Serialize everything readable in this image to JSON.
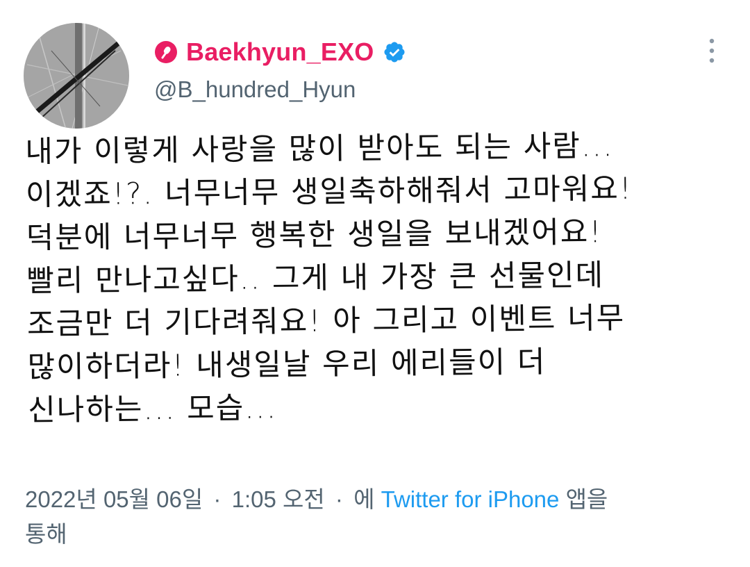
{
  "author": {
    "display_name": "Baekhyun_EXO",
    "handle": "@B_hundred_Hyun",
    "name_color": "#e91e63",
    "badge_icon": "microphone-badge-icon",
    "verified_icon": "verified-badge-icon"
  },
  "tweet": {
    "lines": [
      "내가 이렇게 사랑을 많이 받아도 되는 사람...",
      "이겠죠!?. 너무너무 생일축하해줘서 고마워요!",
      "덕분에 너무너무 행복한 생일을 보내겠어요!",
      "빨리 만나고싶다.. 그게 내 가장 큰 선물인데",
      "조금만 더 기다려줘요! 아 그리고 이벤트 너무",
      "많이하더라! 내생일날 우리 에리들이 더",
      "신나하는... 모습..."
    ]
  },
  "meta": {
    "date": "2022년 05월 06일",
    "time": "1:05 오전",
    "separator": "·",
    "via_prefix": "에",
    "source": "Twitter for iPhone",
    "via_suffix_1": "앱을",
    "via_suffix_2": "통해"
  },
  "colors": {
    "link": "#1d9bf0",
    "muted": "#536471",
    "verified": "#1d9bf0"
  }
}
